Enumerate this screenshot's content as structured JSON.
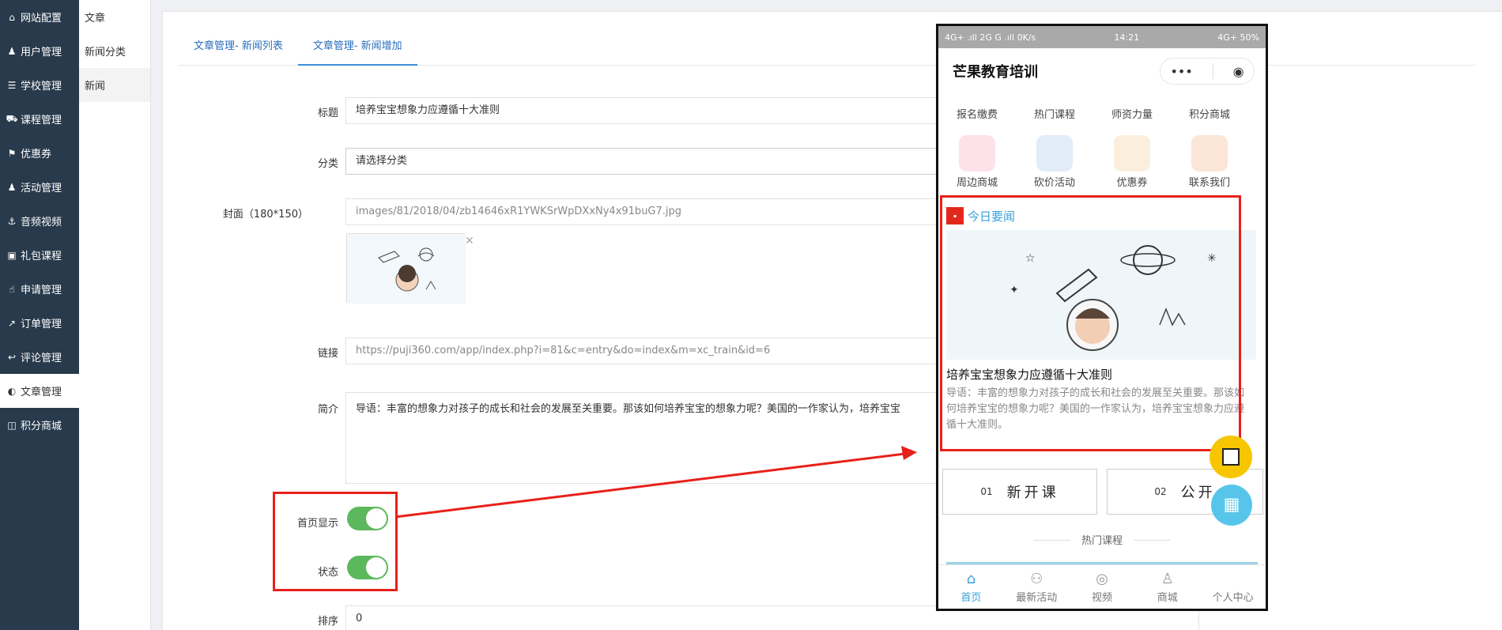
{
  "sidebar": {
    "items": [
      {
        "label": "网站配置",
        "icon": "home-icon"
      },
      {
        "label": "用户管理",
        "icon": "user-icon"
      },
      {
        "label": "学校管理",
        "icon": "list-icon"
      },
      {
        "label": "课程管理",
        "icon": "cart-icon"
      },
      {
        "label": "优惠券",
        "icon": "flag-icon"
      },
      {
        "label": "活动管理",
        "icon": "users-icon"
      },
      {
        "label": "音频视频",
        "icon": "anchor-icon"
      },
      {
        "label": "礼包课程",
        "icon": "gift-icon"
      },
      {
        "label": "申请管理",
        "icon": "hand-icon"
      },
      {
        "label": "订单管理",
        "icon": "share-icon"
      },
      {
        "label": "评论管理",
        "icon": "reply-icon"
      },
      {
        "label": "文章管理",
        "icon": "contrast-icon"
      },
      {
        "label": "积分商城",
        "icon": "store-icon"
      }
    ]
  },
  "subnav": {
    "items": [
      {
        "label": "文章"
      },
      {
        "label": "新闻分类"
      },
      {
        "label": "新闻"
      }
    ]
  },
  "tabs": [
    {
      "label": "文章管理- 新闻列表"
    },
    {
      "label": "文章管理- 新闻增加"
    }
  ],
  "form": {
    "title_label": "标题",
    "title_value": "培养宝宝想象力应遵循十大准则",
    "category_label": "分类",
    "category_placeholder": "请选择分类",
    "cover_label": "封面（180*150）",
    "cover_value": "images/81/2018/04/zb14646xR1YWKSrWpDXxNy4x91buG7.jpg",
    "link_label": "链接",
    "link_value": "https://puji360.com/app/index.php?i=81&c=entry&do=index&m=xc_train&id=6",
    "intro_label": "简介",
    "intro_value": "导语：丰富的想象力对孩子的成长和社会的发展至关重要。那该如何培养宝宝的想象力呢？美国的一作家认为，培养宝宝",
    "home_display_label": "首页显示",
    "status_label": "状态",
    "sort_label": "排序",
    "sort_value": "0"
  },
  "phone": {
    "status_left": "4G+ .ıll 2G G .ıll 0K/s",
    "status_time": "14:21",
    "status_right": "4G+ 50%",
    "app_title": "芒果教育培训",
    "capsule_more": "•••",
    "capsule_close": "◉",
    "grid": [
      {
        "label": "报名缴费",
        "color": "#f4c76a"
      },
      {
        "label": "热门课程",
        "color": "#d9935b"
      },
      {
        "label": "师资力量",
        "color": "#4a6bd1"
      },
      {
        "label": "积分商城",
        "color": "#5b66d6"
      },
      {
        "label": "周边商城",
        "color": "#e86a8a"
      },
      {
        "label": "砍价活动",
        "color": "#5b88c9"
      },
      {
        "label": "优惠券",
        "color": "#e8a86b"
      },
      {
        "label": "联系我们",
        "color": "#e07a3f"
      }
    ],
    "news": {
      "section": "今日要闻",
      "title": "培养宝宝想象力应遵循十大准则",
      "desc": "导语：丰富的想象力对孩子的成长和社会的发展至关重要。那该如何培养宝宝的想象力呢？美国的一作家认为，培养宝宝想象力应遵循十大准则。"
    },
    "promos": [
      {
        "num": "01",
        "text": "新开课"
      },
      {
        "num": "02",
        "text": "公开"
      }
    ],
    "hot_title": "热门课程",
    "tabbar": [
      {
        "label": "首页",
        "icon": "⌂"
      },
      {
        "label": "最新活动",
        "icon": "⚇"
      },
      {
        "label": "视频",
        "icon": "◎"
      },
      {
        "label": "商城",
        "icon": "♙"
      },
      {
        "label": "个人中心",
        "icon": ""
      }
    ]
  },
  "colors": {
    "sidebar_bg": "#283a4c",
    "accent": "#3d8dd8",
    "switch_on": "#5cb85c",
    "highlight": "#e8201a"
  }
}
